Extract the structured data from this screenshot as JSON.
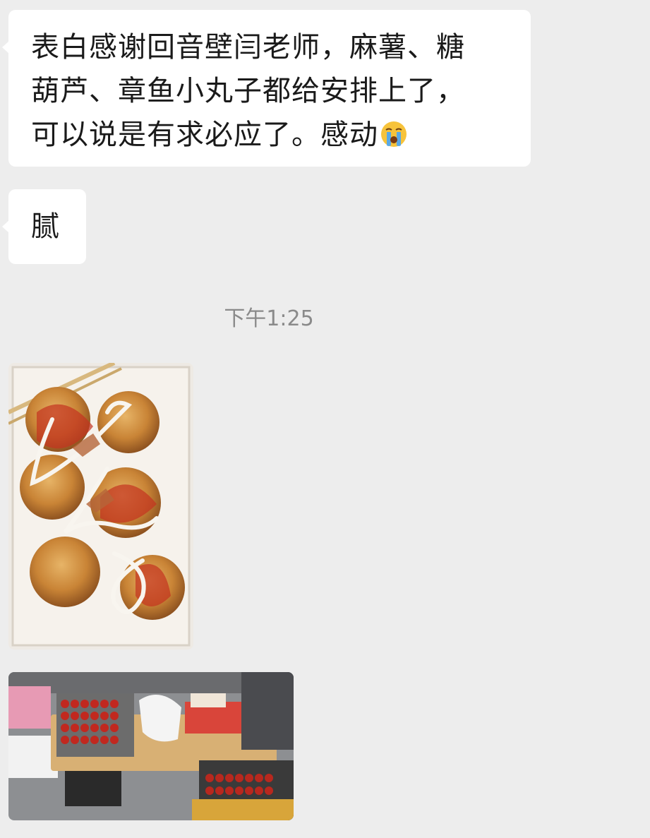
{
  "messages": [
    {
      "type": "text",
      "lines": [
        "表白感谢回音壁闫老师，麻薯、糖",
        "葫芦、章鱼小丸子都给安排上了，",
        "可以说是有求必应了。感动"
      ],
      "emoji": "loudly-crying-face"
    },
    {
      "type": "text",
      "text": "腻"
    }
  ],
  "timestamp": "下午1:25",
  "images": [
    {
      "name": "takoyaki-photo"
    },
    {
      "name": "tanghulu-stall-photo"
    }
  ],
  "colors": {
    "background": "#ededed",
    "bubble": "#ffffff",
    "text": "#1a1a1a",
    "timestamp": "#8a8a8a"
  }
}
